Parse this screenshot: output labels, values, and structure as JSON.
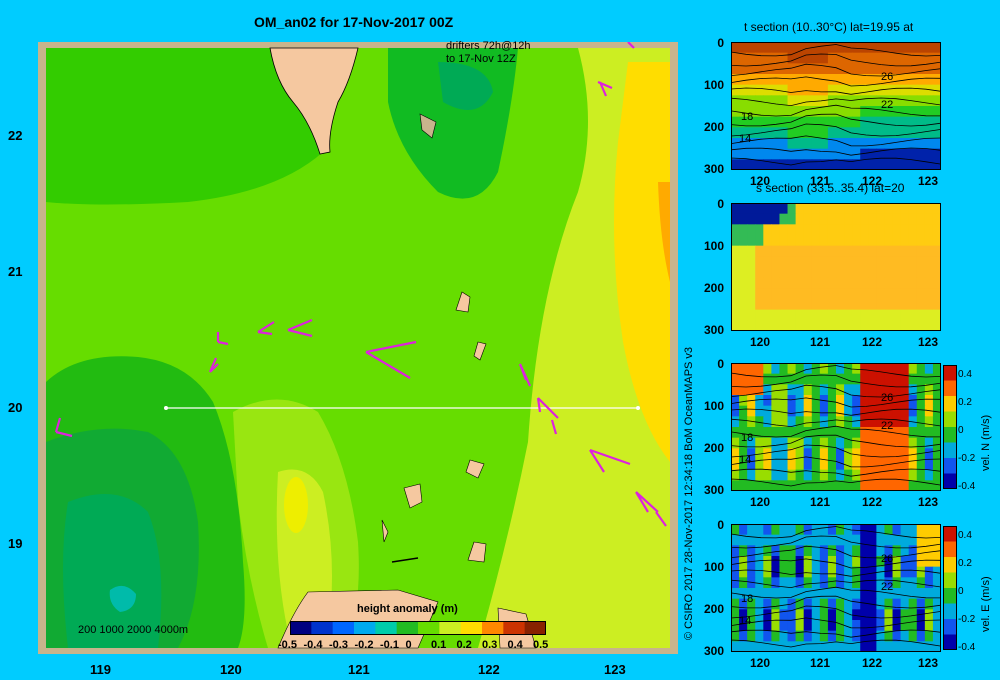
{
  "title": "OM_an02 for 17-Nov-2017 00Z",
  "drifters_note": [
    "drifters 72h@12h",
    "to 17-Nov 12Z"
  ],
  "depth_legend": "200  1000  2000  4000m",
  "credit": "© CSIRO 2017   28-Nov-2017 12:34:18 BoM OceanMAPS v3",
  "map": {
    "lon_ticks": [
      "119",
      "120",
      "121",
      "122",
      "123"
    ],
    "lat_ticks": [
      "22",
      "21",
      "20",
      "19"
    ],
    "section_line": {
      "lat": 20,
      "lon_start": 119.5,
      "lon_end": 123.2
    }
  },
  "colorbar": {
    "title": "height anomaly (m)",
    "ticks": [
      "-0.5",
      "-0.4",
      "-0.3",
      "-0.2",
      "-0.1",
      "0",
      "0.1",
      "0.2",
      "0.3",
      "0.4",
      "0.5"
    ],
    "colors": [
      "#000080",
      "#0033cc",
      "#0066ff",
      "#00aaee",
      "#00ccaa",
      "#22bb22",
      "#66dd00",
      "#ccee22",
      "#ffdd00",
      "#ff8800",
      "#cc3300",
      "#882200"
    ]
  },
  "panels": [
    {
      "title": "t section (10..30°C) lat=19.95 at",
      "x_ticks": [
        "120",
        "121",
        "122",
        "123"
      ],
      "y_ticks": [
        "0",
        "100",
        "200",
        "300"
      ],
      "contour_labels": [
        "26",
        "22",
        "18",
        "14"
      ],
      "colorbar": null
    },
    {
      "title": "s section (33.5..35.4) lat=20",
      "x_ticks": [
        "120",
        "121",
        "122",
        "123"
      ],
      "y_ticks": [
        "0",
        "100",
        "200",
        "300"
      ],
      "contour_labels": [],
      "colorbar": null
    },
    {
      "title": "",
      "x_ticks": [
        "120",
        "121",
        "122",
        "123"
      ],
      "y_ticks": [
        "0",
        "100",
        "200",
        "300"
      ],
      "contour_labels": [
        "26",
        "22",
        "18",
        "14"
      ],
      "colorbar": {
        "label": "vel. N (m/s)",
        "ticks": [
          "0.4",
          "0.2",
          "0",
          "-0.2",
          "-0.4"
        ]
      }
    },
    {
      "title": "",
      "x_ticks": [
        "120",
        "121",
        "122",
        "123"
      ],
      "y_ticks": [
        "0",
        "100",
        "200",
        "300"
      ],
      "contour_labels": [
        "26",
        "22",
        "18",
        "14"
      ],
      "colorbar": {
        "label": "vel. E (m/s)",
        "ticks": [
          "0.4",
          "0.2",
          "0",
          "-0.2",
          "-0.4"
        ]
      }
    }
  ]
}
